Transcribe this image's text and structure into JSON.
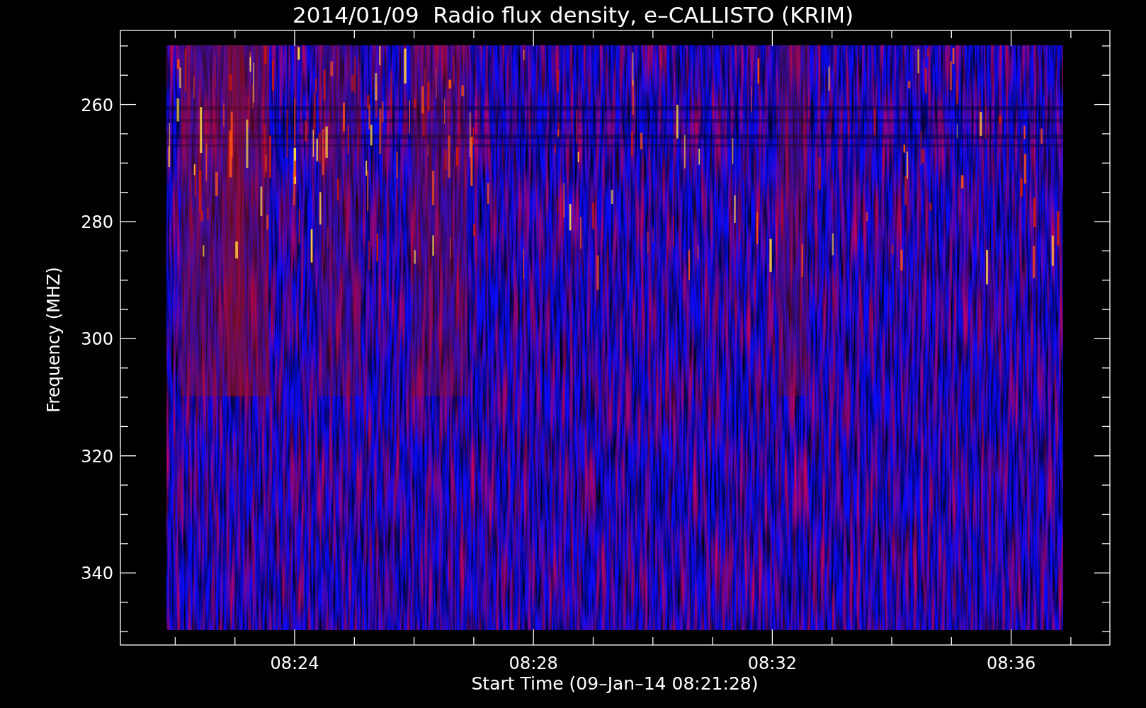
{
  "title": "2014/01/09  Radio flux density, e–CALLISTO (KRIM)",
  "y_axis": {
    "label": "Frequency (MHZ)",
    "ticks": [
      "260",
      "280",
      "300",
      "320",
      "340"
    ]
  },
  "x_axis": {
    "label": "Start Time (09–Jan–14 08:21:28)",
    "ticks": [
      "08:24",
      "08:28",
      "08:32",
      "08:36"
    ]
  }
}
